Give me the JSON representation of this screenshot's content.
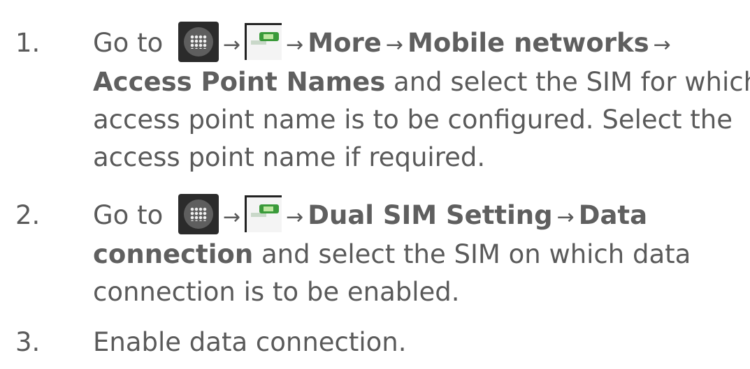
{
  "steps": [
    {
      "number": "1.",
      "go_to": "Go to",
      "arrow": "→",
      "item1": "More",
      "item2": "Mobile networks",
      "item3": "Access Point Names",
      "text_a": " and select the SIM for which",
      "text_b": "access point name is to be configured. Select the",
      "text_c": "access point name if required."
    },
    {
      "number": "2.",
      "go_to": "Go to",
      "arrow": "→",
      "item1": "Dual SIM Setting",
      "item2": "Data",
      "item3": "connection",
      "text_a": " and select the SIM on which data",
      "text_b": "connection is to be enabled."
    },
    {
      "number": "3.",
      "text": "Enable data connection."
    }
  ],
  "icons": {
    "apps": "apps-launcher-icon",
    "settings": "settings-icon"
  },
  "colors": {
    "text": "#5a5a5a",
    "apps_icon_bg": "#2b2b2b",
    "toggle_green": "#3a9a3a"
  }
}
